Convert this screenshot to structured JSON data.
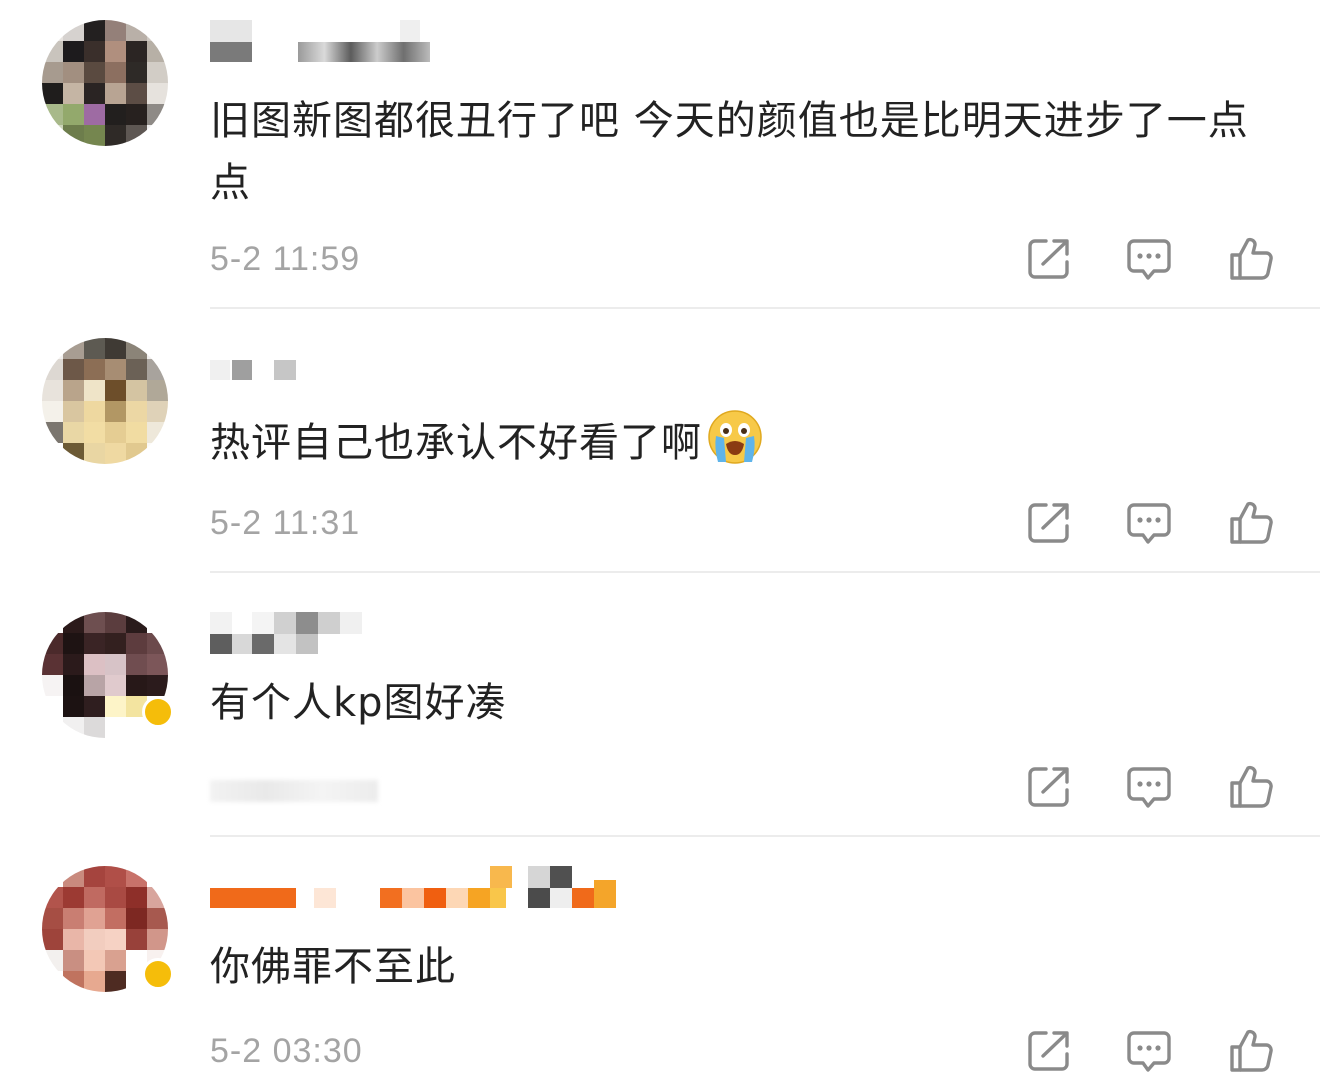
{
  "comments": [
    {
      "text": "旧图新图都很丑行了吧 今天的颜值也是比明天进步了一点点",
      "time": "5-2 11:59"
    },
    {
      "text": "热评自己也承认不好看了啊",
      "time": "5-2 11:31",
      "emoji": "loudly-crying-face"
    },
    {
      "text": "有个人kp图好凑",
      "time": ""
    },
    {
      "text": "你佛罪不至此",
      "time": "5-2 03:30"
    }
  ],
  "icons": {
    "share": "share-icon",
    "comment": "comment-icon",
    "like": "thumbs-up-icon"
  },
  "colors": {
    "text": "#222222",
    "meta": "#a4a4a4",
    "icon": "#8a8a8a",
    "divider": "#ececec",
    "badge": "#f5bd0a"
  }
}
